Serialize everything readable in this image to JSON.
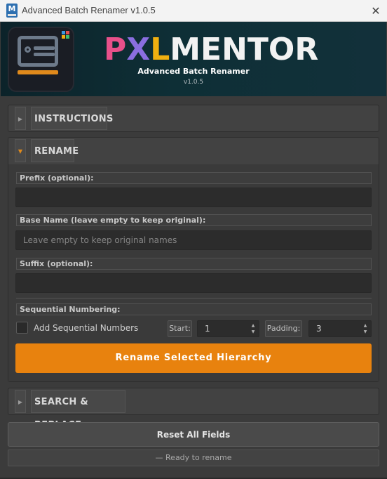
{
  "window": {
    "title": "Advanced Batch Renamer v1.0.5",
    "app_icon_letter": "M",
    "close_glyph": "✕"
  },
  "banner": {
    "brand_p": "P",
    "brand_x": "X",
    "brand_l": "L",
    "brand_rest": "MENTOR",
    "subtitle": "Advanced Batch Renamer",
    "version": "v1.0.5",
    "accent_color": "#e08a1c"
  },
  "sections": {
    "instructions": {
      "label": "INSTRUCTIONS",
      "arrow": "▶",
      "expanded": false
    },
    "rename": {
      "label": "RENAME",
      "arrow": "▼",
      "expanded": true
    },
    "search_replace": {
      "label": "SEARCH & REPLACE",
      "arrow": "▶",
      "expanded": false
    }
  },
  "rename": {
    "prefix_label": "Prefix  (optional):",
    "prefix_value": "",
    "base_name_label": "Base Name  (leave empty to keep original):",
    "base_name_placeholder": "Leave empty to keep original names",
    "suffix_label": "Suffix  (optional):",
    "suffix_value": "",
    "seq_label": "Sequential Numbering:",
    "seq_checkbox_label": "Add Sequential Numbers",
    "seq_checked": false,
    "start_label": "Start:",
    "start_value": "1",
    "padding_label": "Padding:",
    "padding_value": "3",
    "rename_button": "Rename Selected Hierarchy",
    "button_color": "#e8820e"
  },
  "footer": {
    "reset_button": "Reset All Fields",
    "status": "—  Ready to rename"
  }
}
